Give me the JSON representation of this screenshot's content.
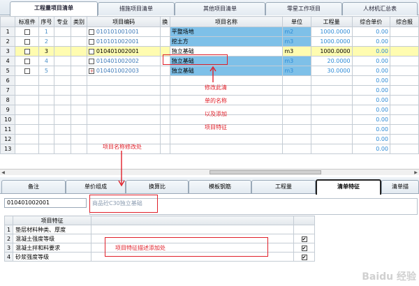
{
  "top_tabs": [
    {
      "label": "工程量项目清单",
      "active": true
    },
    {
      "label": "措施项目清单",
      "active": false
    },
    {
      "label": "其他项目清单",
      "active": false
    },
    {
      "label": "零星工作项目",
      "active": false
    },
    {
      "label": "人材机汇总表",
      "active": false
    }
  ],
  "grid": {
    "headers": [
      "",
      "标准件",
      "序号",
      "专业",
      "类别",
      "项目编码",
      "换",
      "项目名称",
      "单位",
      "工程量",
      "综合单价",
      "综合报"
    ],
    "rows": [
      {
        "n": "1",
        "seq": "1",
        "code": "010101001001",
        "name": "平整场地",
        "unit": "m2",
        "qty": "1000.0000",
        "price": "0.00"
      },
      {
        "n": "2",
        "seq": "2",
        "code": "010101002001",
        "name": "挖土方",
        "unit": "m3",
        "qty": "1000.0000",
        "price": "0.00"
      },
      {
        "n": "3",
        "seq": "3",
        "code": "010401002001",
        "name": "独立基础",
        "unit": "m3",
        "qty": "1000.0000",
        "price": "0.00"
      },
      {
        "n": "4",
        "seq": "4",
        "code": "010401002002",
        "name": "独立基础",
        "unit": "m3",
        "qty": "20.0000",
        "price": "0.00"
      },
      {
        "n": "5",
        "seq": "5",
        "code": "010401002003",
        "name": "独立基础",
        "unit": "m3",
        "qty": "30.0000",
        "price": "0.00"
      },
      {
        "n": "6",
        "price": "0.00"
      },
      {
        "n": "7",
        "price": "0.00"
      },
      {
        "n": "8",
        "price": "0.00"
      },
      {
        "n": "9",
        "price": "0.00"
      },
      {
        "n": "10",
        "price": "0.00"
      },
      {
        "n": "11",
        "price": "0.00"
      },
      {
        "n": "12",
        "price": "0.00"
      },
      {
        "n": "13",
        "price": "0.00"
      }
    ]
  },
  "bottom_tabs": [
    "备注",
    "单价组成",
    "换算比",
    "模板钢筋",
    "工程量",
    "清单特征",
    "清单描"
  ],
  "bottom": {
    "code_value": "010401002001",
    "description": "商品砼C30独立基础",
    "feature_header": "项目特征",
    "features": [
      {
        "n": "1",
        "label": "垫层材料种类、厚度",
        "checked": false
      },
      {
        "n": "2",
        "label": "混凝土强度等级",
        "checked": true
      },
      {
        "n": "3",
        "label": "混凝土拌和料要求",
        "checked": true
      },
      {
        "n": "4",
        "label": "砂浆强度等级",
        "checked": true
      }
    ]
  },
  "annotations": {
    "name_edit_note": [
      "修改此清",
      "单的名称",
      "以及添加",
      "项目特征"
    ],
    "name_edit_location": "项目名称修改处",
    "feature_add_location": "项目特征描述添加处"
  },
  "colors": {
    "annotation_red": "#e0202a",
    "selected_row": "#fffcb0",
    "name_highlight": "#7ec0e8",
    "value_blue": "#2e8bd6"
  },
  "watermark": "Baidu 经验"
}
